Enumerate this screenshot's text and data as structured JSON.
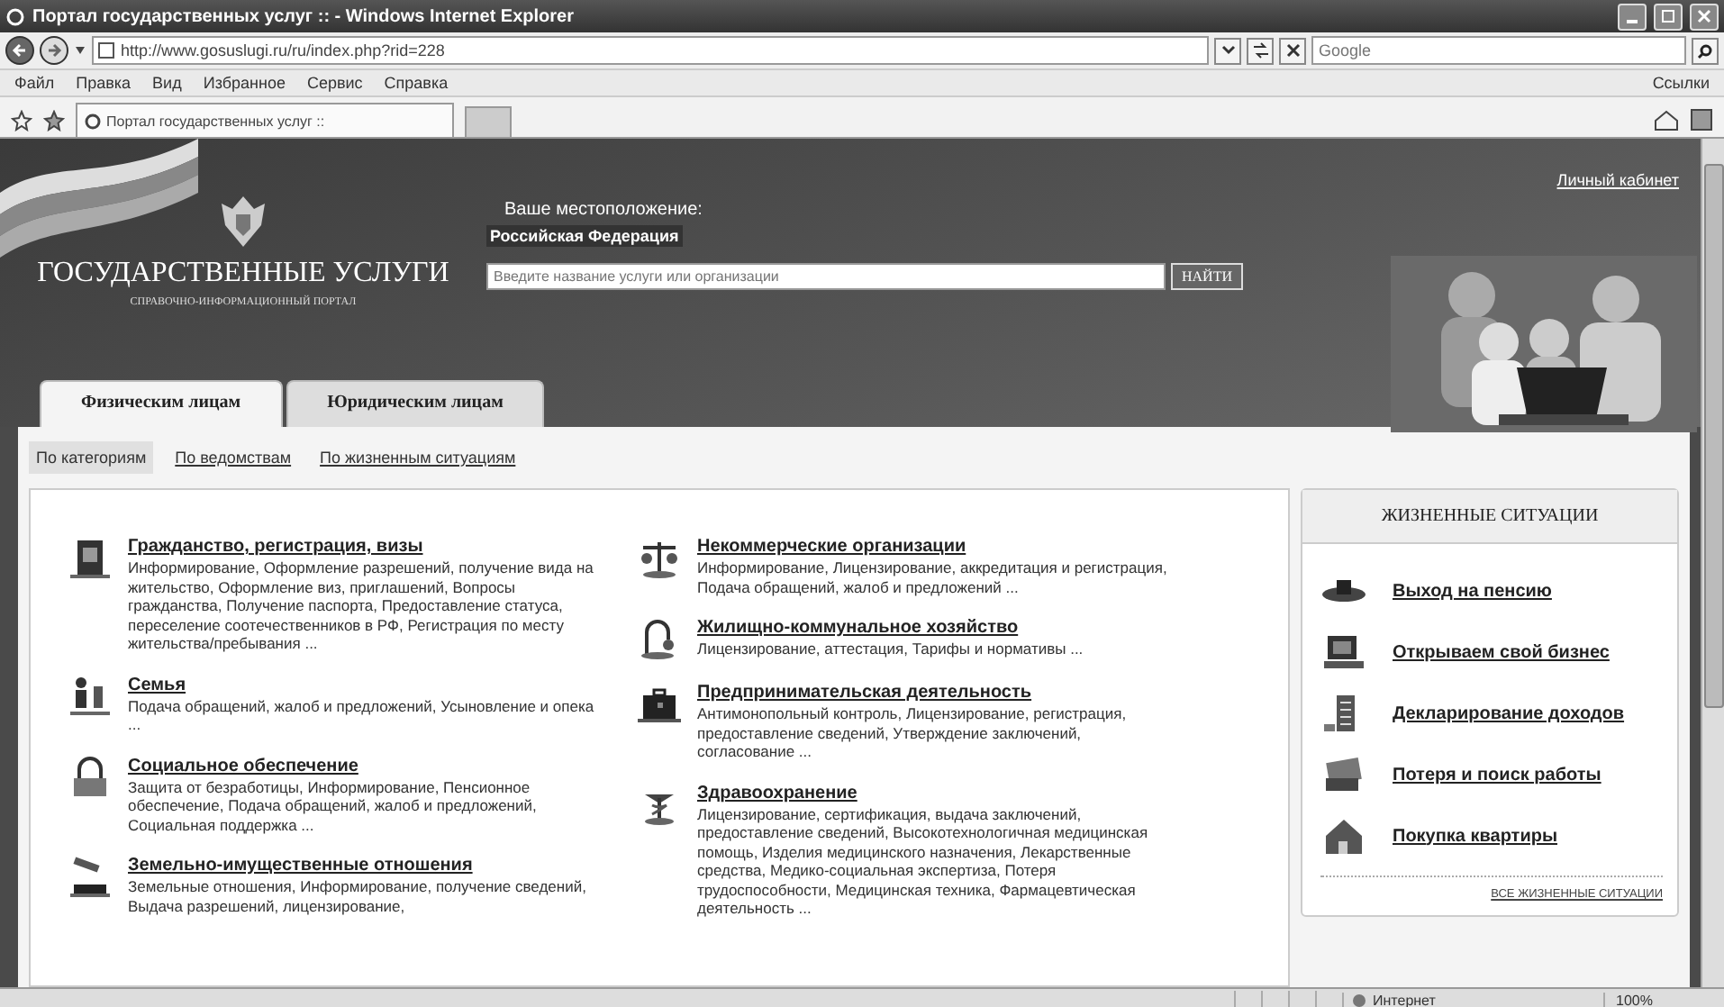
{
  "window": {
    "title": "Портал государственных услуг :: - Windows Internet Explorer"
  },
  "address_bar": {
    "url": "http://www.gosuslugi.ru/ru/index.php?rid=228",
    "search_placeholder": "Google"
  },
  "menu": [
    "Файл",
    "Правка",
    "Вид",
    "Избранное",
    "Сервис",
    "Справка"
  ],
  "links_label": "Ссылки",
  "browser_tabs": [
    {
      "title": "Портал государственных услуг ::",
      "selected": true
    }
  ],
  "header": {
    "location_label": "Ваше местоположение:",
    "location": "Российская Федерация",
    "account_link": "Личный кабинет",
    "logo_title": "ГОСУДАРСТВЕННЫЕ УСЛУГИ",
    "logo_subtitle": "СПРАВОЧНО-ИНФОРМАЦИОННЫЙ ПОРТАЛ",
    "search_placeholder": "Введите название услуги или организации",
    "search_button": "НАЙТИ"
  },
  "audience_tabs": [
    {
      "label": "Физическим лицам",
      "selected": true
    },
    {
      "label": "Юридическим лицам",
      "selected": false
    }
  ],
  "subnav": [
    {
      "label": "По категориям",
      "selected": true
    },
    {
      "label": "По ведомствам",
      "selected": false
    },
    {
      "label": "По жизненным ситуациям",
      "selected": false
    }
  ],
  "categories_left": [
    {
      "title": "Гражданство, регистрация, визы",
      "description": "Информирование, Оформление разрешений, получение вида на жительство, Оформление виз, приглашений, Вопросы гражданства, Получение паспорта, Предоставление статуса, переселение соотечественников в РФ, Регистрация по месту жительства/пребывания ..."
    },
    {
      "title": "Семья",
      "description": "Подача обращений, жалоб и предложений, Усыновление и опека ..."
    },
    {
      "title": "Социальное обеспечение",
      "description": "Защита от безработицы, Информирование, Пенсионное обеспечение, Подача обращений, жалоб и предложений, Социальная поддержка ..."
    },
    {
      "title": "Земельно-имущественные отношения",
      "description": "Земельные отношения, Информирование, получение сведений, Выдача разрешений, лицензирование,"
    }
  ],
  "categories_right": [
    {
      "title": "Некоммерческие организации",
      "description": "Информирование, Лицензирование, аккредитация и регистрация, Подача обращений, жалоб и предложений ..."
    },
    {
      "title": "Жилищно-коммунальное хозяйство",
      "description": "Лицензирование, аттестация, Тарифы и нормативы ..."
    },
    {
      "title": "Предпринимательская деятельность",
      "description": "Антимонопольный контроль, Лицензирование, регистрация, предоставление сведений, Утверждение заключений, согласование ..."
    },
    {
      "title": "Здравоохранение",
      "description": "Лицензирование, сертификация, выдача заключений, предоставление сведений, Высокотехнологичная медицинская помощь, Изделия медицинского назначения, Лекарственные средства, Медико-социальная экспертиза, Потеря трудоспособности, Медицинская техника, Фармацевтическая деятельность ..."
    }
  ],
  "life_situations": {
    "title": "ЖИЗНЕННЫЕ СИТУАЦИИ",
    "items": [
      "Выход на пенсию",
      "Открываем свой бизнес",
      "Декларирование доходов",
      "Потеря и поиск работы",
      "Покупка квартиры"
    ],
    "all_link": "ВСЕ ЖИЗНЕННЫЕ СИТУАЦИИ"
  },
  "status_bar": {
    "zone": "Интернет",
    "zoom": "100%"
  }
}
